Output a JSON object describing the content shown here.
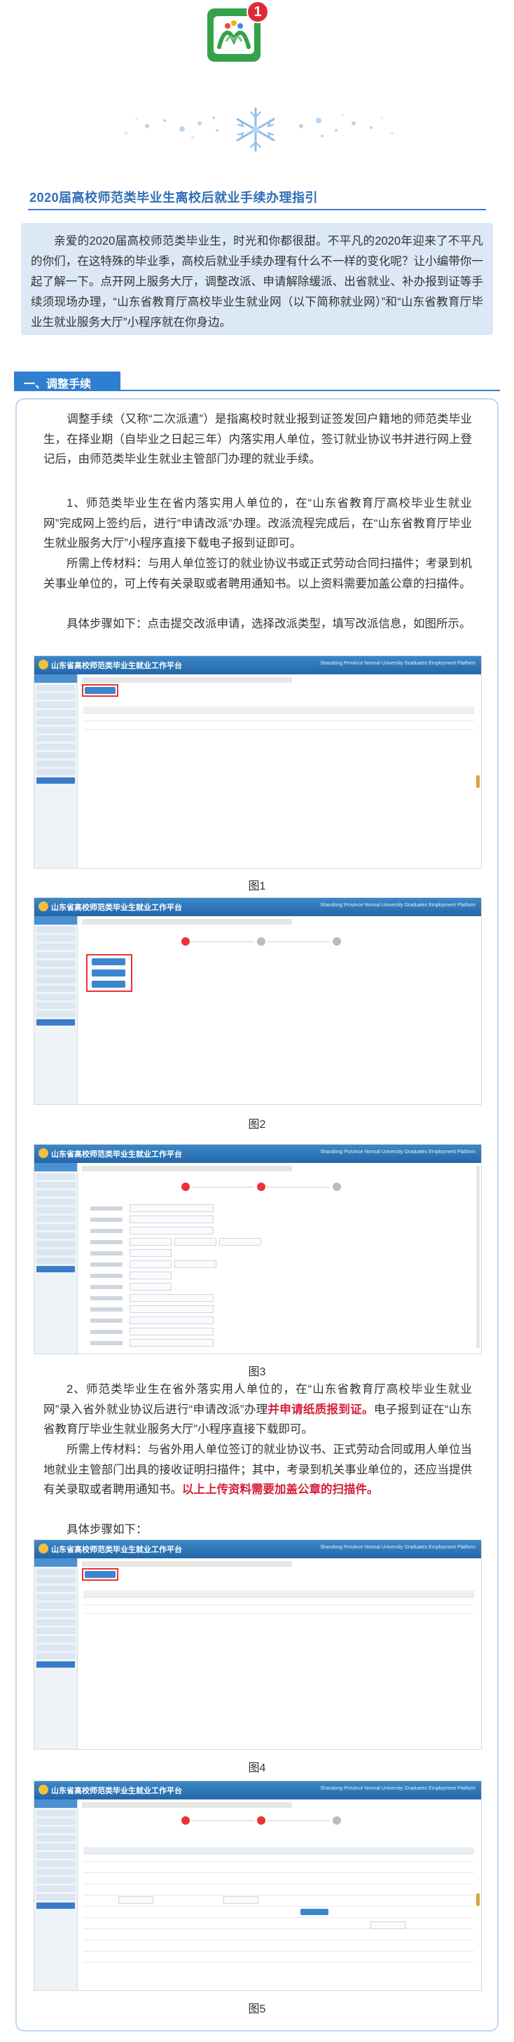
{
  "header": {
    "logo_icon": "green-logo-icon",
    "badge_count": "1",
    "decor_icon": "snowflake-icon"
  },
  "title": "2020届高校师范类毕业生离校后就业手续办理指引",
  "intro": "亲爱的2020届高校师范类毕业生，时光和你都很甜。不平凡的2020年迎来了不平凡的你们，在这特殊的毕业季，高校后就业手续办理有什么不一样的变化呢？让小编带你一起了解一下。点开网上服务大厅，调整改派、申请解除缓派、出省就业、补办报到证等手续须现场办理，“山东省教育厅高校毕业生就业网（以下简称就业网）”和“山东省教育厅毕业生就业服务大厅”小程序就在你身边。",
  "section1": {
    "label": "一、调整手续"
  },
  "paragraphs": {
    "p1": "调整手续（又称“二次派遣”）是指离校时就业报到证签发回户籍地的师范类毕业生，在择业期（自毕业之日起三年）内落实用人单位，签订就业协议书并进行网上登记后，由师范类毕业生就业主管部门办理的就业手续。",
    "p2": "1、师范类毕业生在省内落实用人单位的，在“山东省教育厅高校毕业生就业网”完成网上签约后，进行“申请改派”办理。改派流程完成后，在“山东省教育厅毕业生就业服务大厅”小程序直接下载电子报到证即可。",
    "p3": "所需上传材料：与用人单位签订的就业协议书或正式劳动合同扫描件；考录到机关事业单位的，可上传有关录取或者聘用通知书。以上资料需要加盖公章的扫描件。",
    "p4": "具体步骤如下：点击提交改派申请，选择改派类型，填写改派信息，如图所示。",
    "p5_a": "2、师范类毕业生在省外落实用人单位的，在“山东省教育厅高校毕业生就业网”录入省外就业协议后进行“申请改派”办理",
    "p5_red": "并申请纸质报到证。",
    "p5_b": "电子报到证在“山东省教育厅毕业生就业服务大厅”小程序直接下载即可。",
    "p6_a": "所需上传材料：与省外用人单位签订的就业协议书、正式劳动合同或用人单位当地就业主管部门出具的接收证明扫描件；其中，考录到机关事业单位的，还应当提供有关录取或者聘用通知书。",
    "p6_red": "以上上传资料需要加盖公章的扫描件。",
    "p7": "具体步骤如下："
  },
  "screens": {
    "app_title": "山东省高校师范类毕业生就业工作平台",
    "app_title_small": "Shandong Province Normal University Graduates Employment Platform"
  },
  "captions": {
    "fig1": "图1",
    "fig2": "图2",
    "fig3": "图3",
    "fig4": "图4",
    "fig5": "图5"
  },
  "colors": {
    "accent_blue": "#2f7fd0",
    "title_blue": "#2f6fb8",
    "intro_bg": "#dce8f5",
    "highlight_red": "#d6213a",
    "logo_green": "#35a24a",
    "badge_red": "#e0283a"
  }
}
